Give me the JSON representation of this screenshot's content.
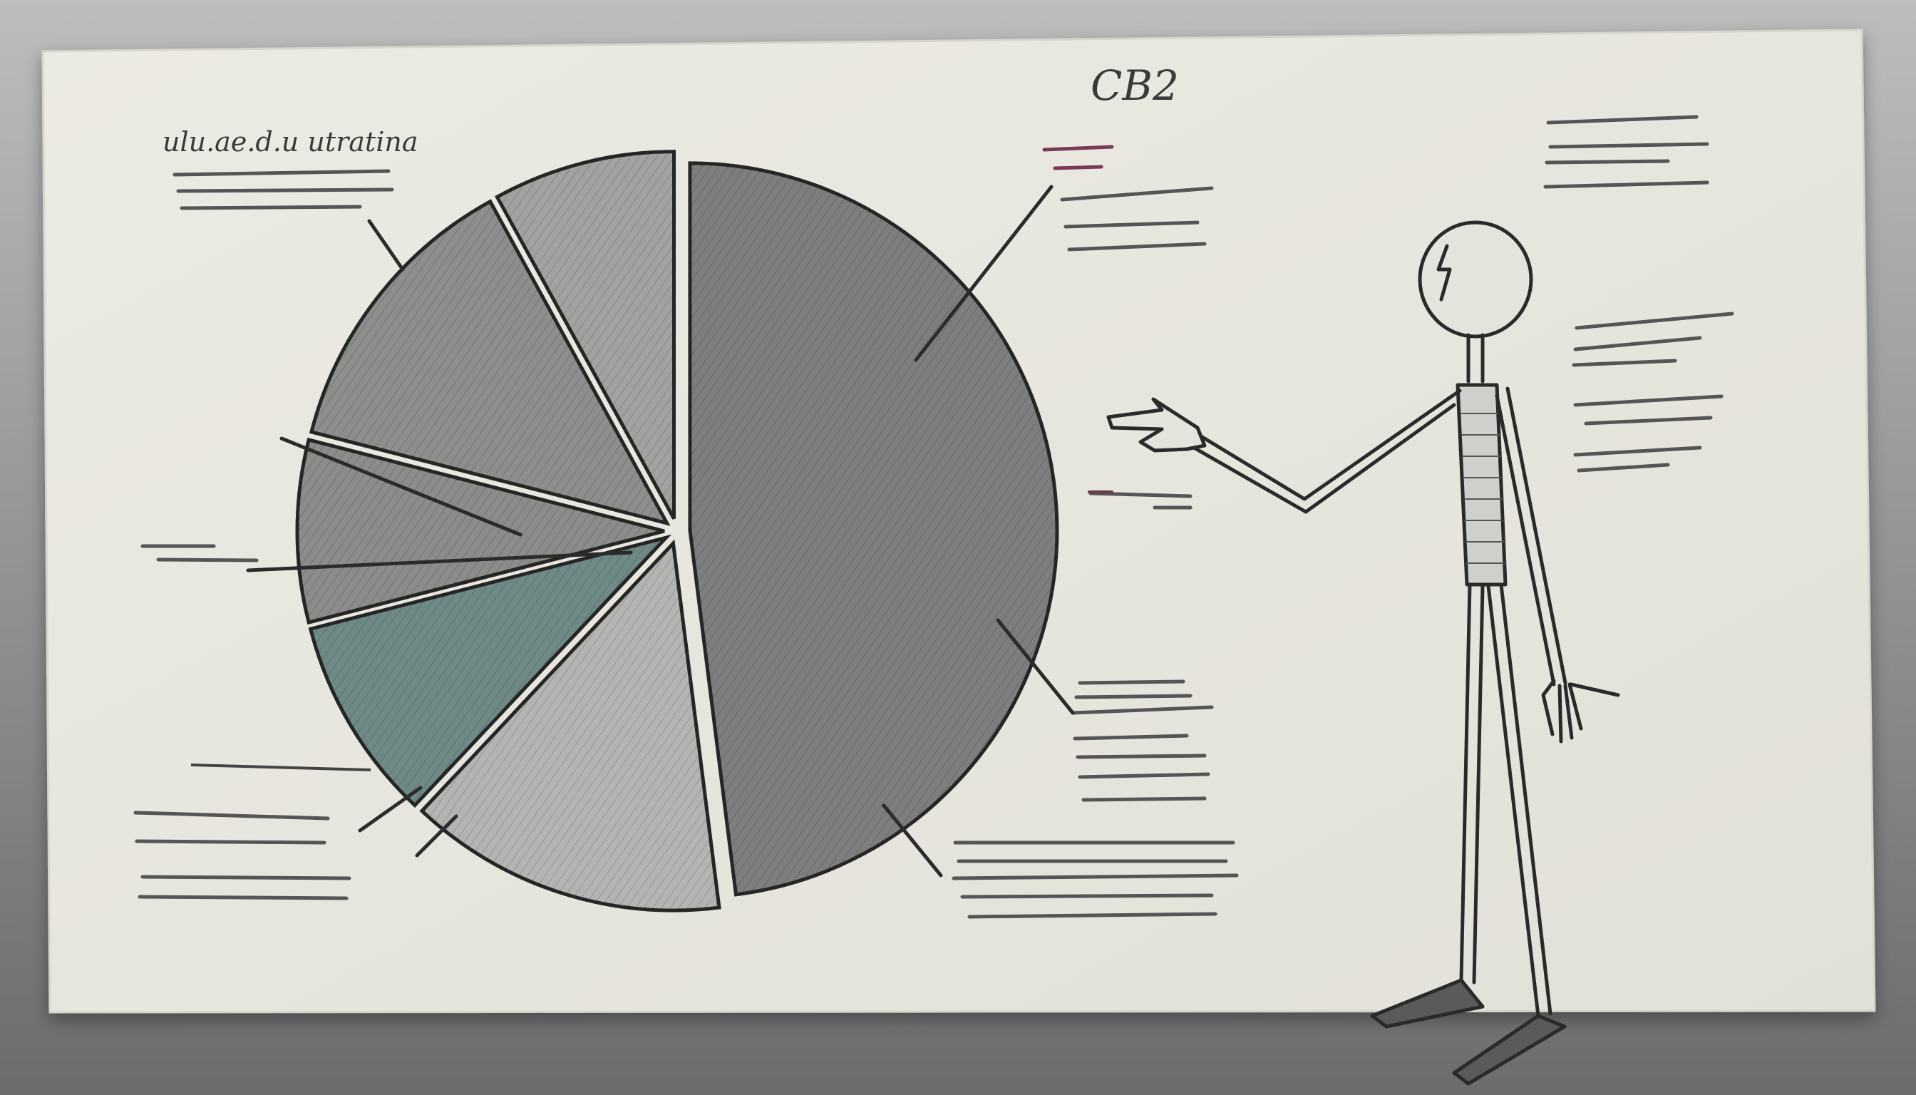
{
  "scene": {
    "description_free": true,
    "colors": {
      "wall_top": "#b9b9b9",
      "wall_bottom": "#6f6f6f",
      "paper": "#e9e8df",
      "ink": "#2a2a2a",
      "teal_slice": "#6f8a86",
      "annotation_magenta": "#7a3a55"
    }
  },
  "texts": {
    "top_scribble": "CB2",
    "left_heading": "ulu.ae.d.u utratina"
  },
  "chart_data": {
    "type": "pie",
    "values": [
      48,
      14,
      9,
      8,
      13,
      8
    ]
  },
  "icons": [
    "stick-figure",
    "pointing-hand",
    "pie-chart"
  ]
}
